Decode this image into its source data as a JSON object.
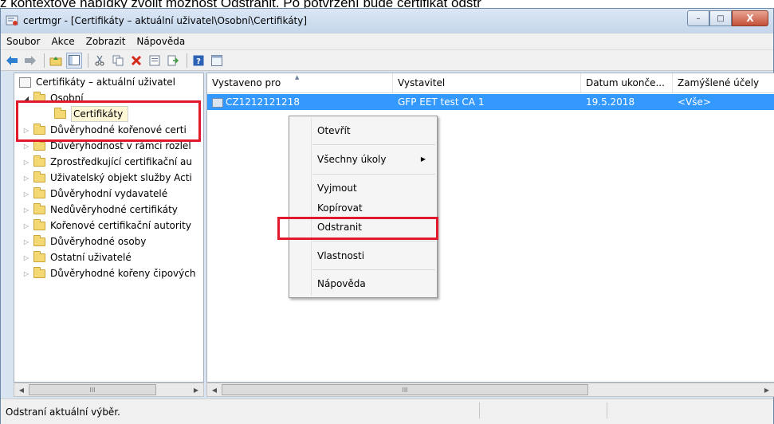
{
  "caption": "z kontextové nabídky zvolit možnost Odstranit. Po potvrzení bude certifikát odstr",
  "window": {
    "title": "certmgr - [Certifikáty – aktuální uživatel\\Osobní\\Certifikáty]",
    "minimize": "–",
    "maximize": "□",
    "close": "X"
  },
  "menubar": [
    "Soubor",
    "Akce",
    "Zobrazit",
    "Nápověda"
  ],
  "toolbar_icons": [
    "back-arrow-icon",
    "forward-arrow-icon",
    "up-folder-icon",
    "show-tree-icon",
    "cut-icon",
    "copy-icon",
    "delete-icon",
    "properties-icon",
    "export-icon",
    "help-icon",
    "console-icon"
  ],
  "tree": {
    "root": "Certifikáty – aktuální uživatel",
    "osobni": "Osobní",
    "certifikaty": "Certifikáty",
    "items": [
      "Důvěryhodné kořenové certi",
      "Důvěryhodnost v rámci rozlel",
      "Zprostředkující certifikační au",
      "Uživatelský objekt služby Acti",
      "Důvěryhodní vydavatelé",
      "Nedůvěryhodné certifikáty",
      "Kořenové certifikační autority",
      "Důvěryhodné osoby",
      "Ostatní uživatelé",
      "Důvěryhodné kořeny čipových"
    ]
  },
  "list": {
    "columns": [
      "Vystaveno pro",
      "Vystavitel",
      "Datum ukonče...",
      "Zamýšlené účely"
    ],
    "row": {
      "issued_to": "CZ1212121218",
      "issuer": "GFP EET test CA 1",
      "expiry": "19.5.2018",
      "purposes": "<Vše>"
    }
  },
  "context_menu": {
    "open": "Otevřít",
    "all_tasks": "Všechny úkoly",
    "cut": "Vyjmout",
    "copy": "Kopírovat",
    "delete": "Odstranit",
    "properties": "Vlastnosti",
    "help": "Nápověda"
  },
  "scroll_grip": "III",
  "status": "Odstraní aktuální výběr.",
  "colors": {
    "highlight": "#e01a2b",
    "selection": "#3399ff"
  }
}
